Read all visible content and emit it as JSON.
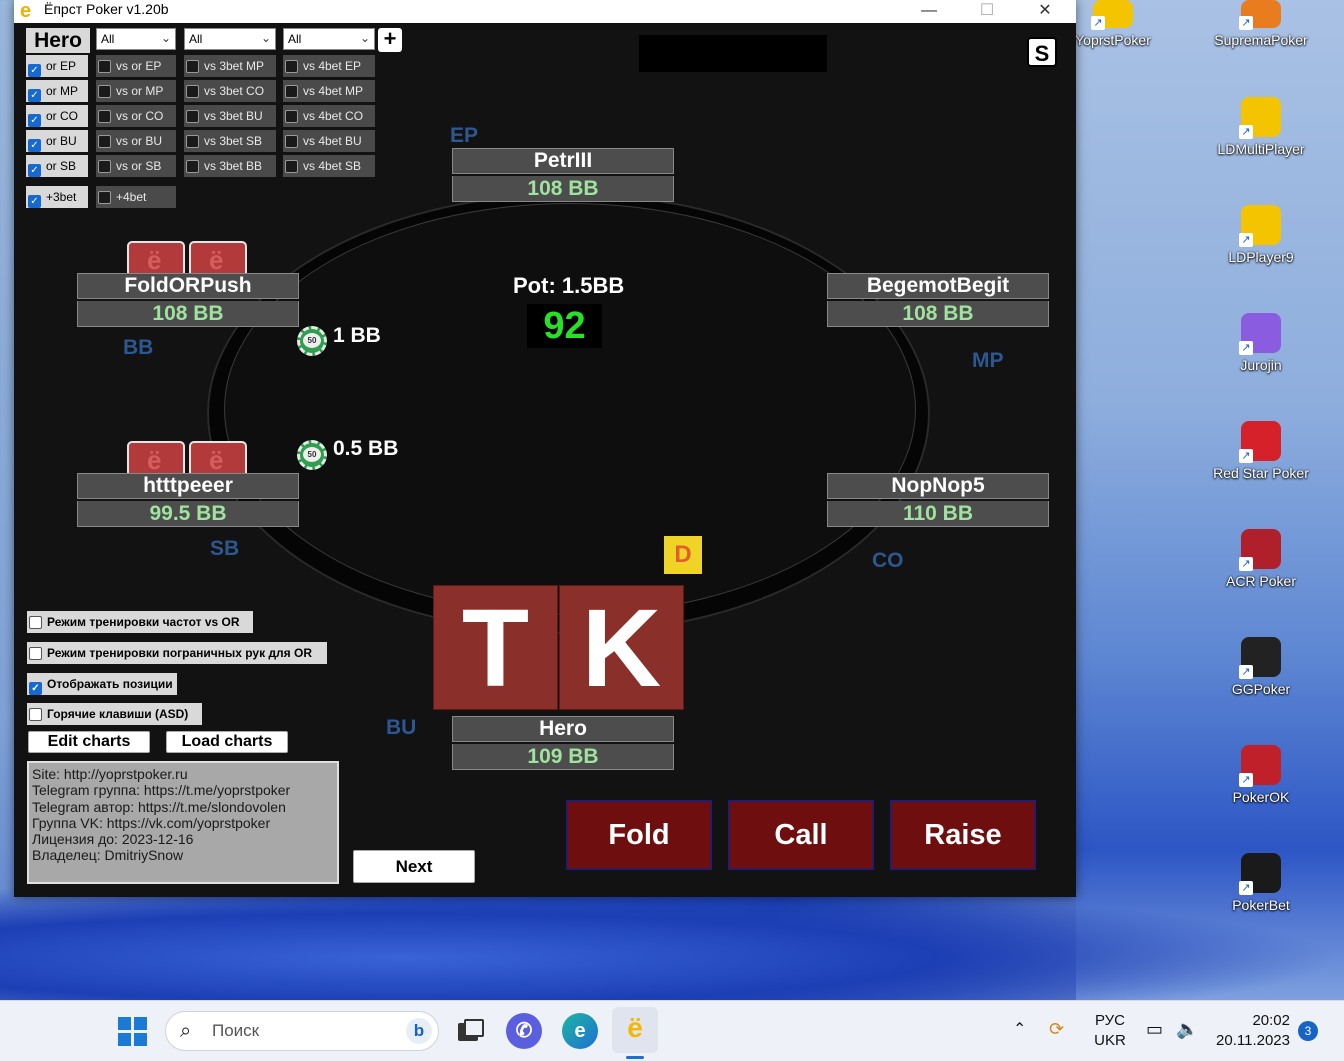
{
  "window": {
    "title": "Ёпрст Poker v1.20b",
    "minimize": "—",
    "maximize": "☐",
    "close": "✕"
  },
  "filters": {
    "hero_label": "Hero",
    "selects": [
      "All",
      "All",
      "All"
    ],
    "plus_label": "+",
    "col1": [
      {
        "label": "or EP",
        "checked": true
      },
      {
        "label": "or MP",
        "checked": true
      },
      {
        "label": "or CO",
        "checked": true
      },
      {
        "label": "or BU",
        "checked": true
      },
      {
        "label": "or SB",
        "checked": true
      }
    ],
    "col2": [
      {
        "label": "vs or EP",
        "checked": false
      },
      {
        "label": "vs or MP",
        "checked": false
      },
      {
        "label": "vs or CO",
        "checked": false
      },
      {
        "label": "vs or BU",
        "checked": false
      },
      {
        "label": "vs or SB",
        "checked": false
      }
    ],
    "col3": [
      {
        "label": "vs 3bet MP",
        "checked": false
      },
      {
        "label": "vs 3bet CO",
        "checked": false
      },
      {
        "label": "vs 3bet BU",
        "checked": false
      },
      {
        "label": "vs 3bet SB",
        "checked": false
      },
      {
        "label": "vs 3bet BB",
        "checked": false
      }
    ],
    "col4": [
      {
        "label": "vs 4bet EP",
        "checked": false
      },
      {
        "label": "vs 4bet MP",
        "checked": false
      },
      {
        "label": "vs 4bet CO",
        "checked": false
      },
      {
        "label": "vs 4bet BU",
        "checked": false
      },
      {
        "label": "vs 4bet SB",
        "checked": false
      }
    ],
    "plus3bet": {
      "label": "+3bet",
      "checked": true
    },
    "plus4bet": {
      "label": "+4bet",
      "checked": false
    }
  },
  "s_button": "S",
  "seats": {
    "ep": {
      "name": "PetrIII",
      "stack": "108 BB",
      "position": "EP"
    },
    "bb": {
      "name": "FoldORPush",
      "stack": "108 BB",
      "position": "BB"
    },
    "mp": {
      "name": "BegemotBegit",
      "stack": "108 BB",
      "position": "MP"
    },
    "sb": {
      "name": "htttpeeer",
      "stack": "99.5 BB",
      "position": "SB"
    },
    "co": {
      "name": "NopNop5",
      "stack": "110 BB",
      "position": "CO"
    },
    "hero": {
      "name": "Hero",
      "stack": "109 BB",
      "position": "BU"
    }
  },
  "bets": {
    "bb": "1 BB",
    "sb": "0.5 BB"
  },
  "pot": "Pot: 1.5BB",
  "timer": "92",
  "dealer": "D",
  "hero_cards": [
    "T",
    "K"
  ],
  "actions": {
    "fold": "Fold",
    "call": "Call",
    "raise": "Raise"
  },
  "options": [
    {
      "label": "Режим тренировки частот vs OR",
      "checked": false
    },
    {
      "label": "Режим тренировки пограничных рук для OR",
      "checked": false
    },
    {
      "label": "Отображать позиции",
      "checked": true
    },
    {
      "label": "Горячие клавиши (ASD)",
      "checked": false
    }
  ],
  "buttons": {
    "edit_charts": "Edit charts",
    "load_charts": "Load charts",
    "next": "Next"
  },
  "info_lines": [
    "Site: http://yoprstpoker.ru",
    "Telegram группа: https://t.me/yoprstpoker",
    "Telegram автор: https://t.me/slondovolen",
    "Группа VK: https://vk.com/yoprstpoker",
    "Лицензия до: 2023-12-16",
    "Владелец: DmitriySnow"
  ],
  "desktop_icons": [
    {
      "label": "YoprstPoker",
      "icon": "yoprst-icon",
      "color": "#f5c400"
    },
    {
      "label": "SupremaPoker",
      "icon": "suprema-icon",
      "color": "#e87c1e"
    },
    {
      "label": "LDMultiPlayer",
      "icon": "ldmulti-icon",
      "color": "#f5c400"
    },
    {
      "label": "LDPlayer9",
      "icon": "ldplayer-icon",
      "color": "#f5c400"
    },
    {
      "label": "Jurojin",
      "icon": "jurojin-icon",
      "color": "#8a5ce0"
    },
    {
      "label": "Red Star Poker",
      "icon": "redstar-icon",
      "color": "#d6202a"
    },
    {
      "label": "ACR Poker",
      "icon": "acr-icon",
      "color": "#b0202a"
    },
    {
      "label": "GGPoker",
      "icon": "ggpoker-icon",
      "color": "#222222"
    },
    {
      "label": "PokerOK",
      "icon": "pokerok-icon",
      "color": "#c0202a"
    },
    {
      "label": "PokerBet",
      "icon": "pokerbet-icon",
      "color": "#1a1a1a"
    }
  ],
  "taskbar": {
    "search_placeholder": "Поиск",
    "lang_top": "РУС",
    "lang_bottom": "UKR",
    "time": "20:02",
    "date": "20.11.2023",
    "notifications": "3",
    "bing": "b"
  }
}
